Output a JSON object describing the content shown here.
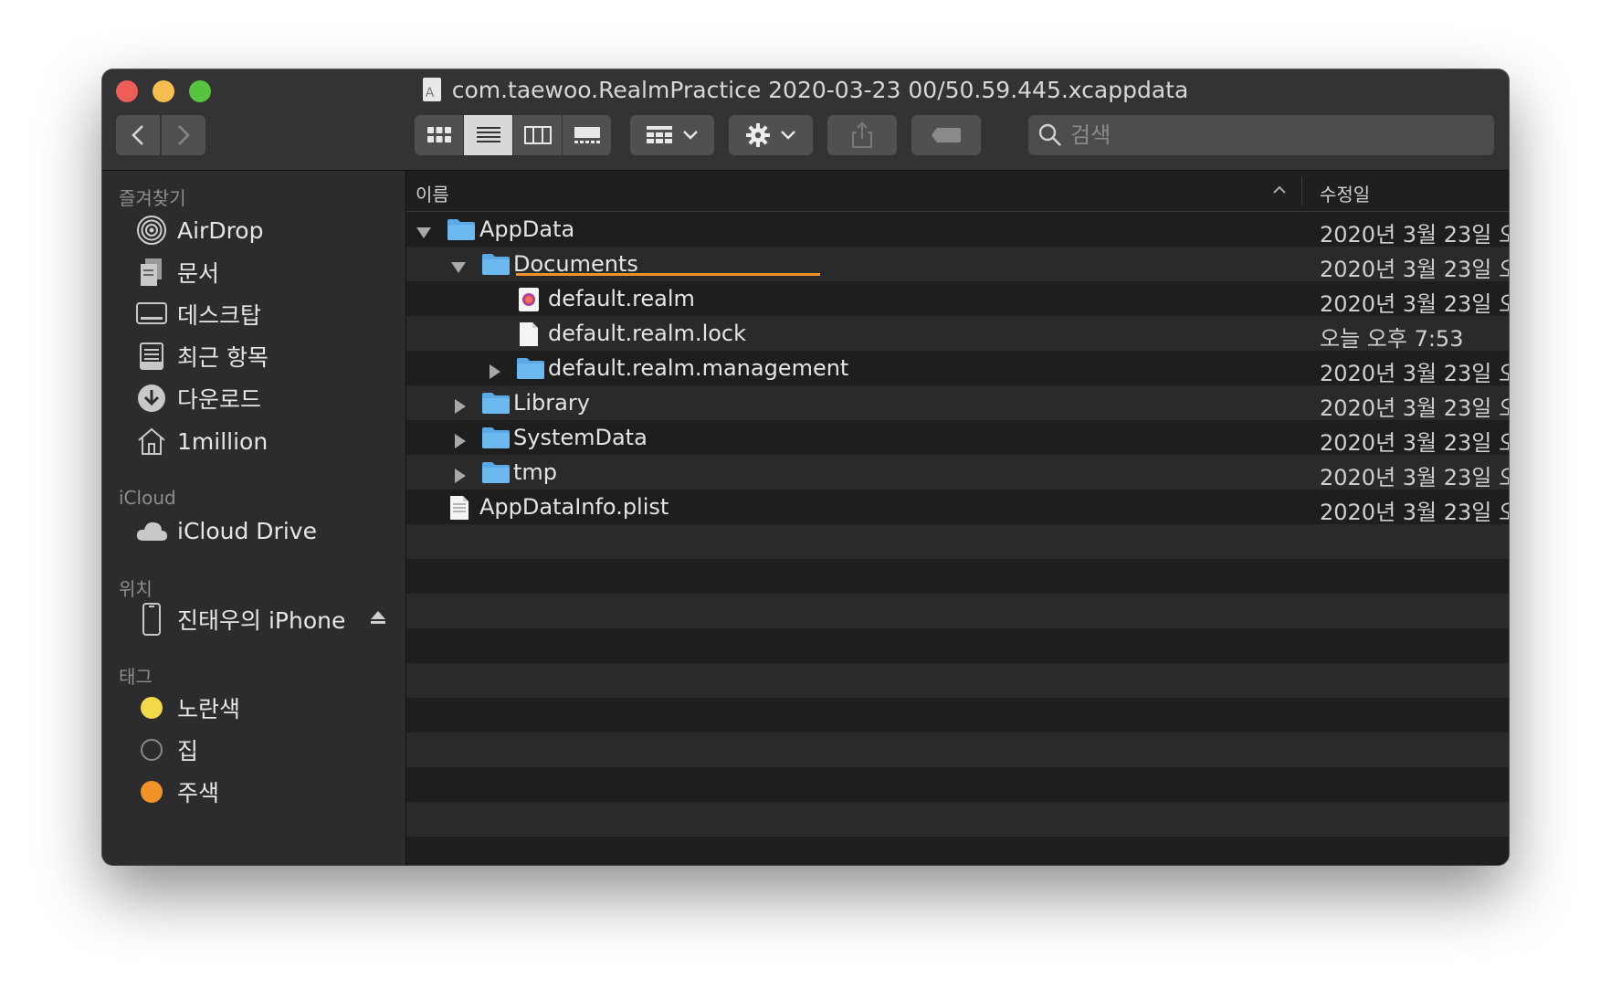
{
  "window": {
    "title": "com.taewoo.RealmPractice 2020-03-23 00/50.59.445.xcappdata"
  },
  "toolbar": {
    "view_modes": [
      "icon-view",
      "list-view",
      "column-view",
      "gallery-view"
    ],
    "active_view": "list-view",
    "search_placeholder": "검색"
  },
  "sidebar": {
    "favorites_header": "즐겨찾기",
    "favorites": [
      {
        "label": "AirDrop",
        "icon": "airdrop-icon"
      },
      {
        "label": "문서",
        "icon": "documents-icon"
      },
      {
        "label": "데스크탑",
        "icon": "desktop-icon"
      },
      {
        "label": "최근 항목",
        "icon": "recents-icon"
      },
      {
        "label": "다운로드",
        "icon": "downloads-icon"
      },
      {
        "label": "1million",
        "icon": "home-icon"
      }
    ],
    "icloud_header": "iCloud",
    "icloud_item": "iCloud Drive",
    "locations_header": "위치",
    "location_item": "진태우의 iPhone",
    "tags_header": "태그",
    "tags": [
      {
        "label": "노란색",
        "color": "#f2d94a"
      },
      {
        "label": "집",
        "color": "transparent"
      },
      {
        "label": "주색",
        "color": "#f2932a"
      }
    ]
  },
  "list": {
    "col_name": "이름",
    "col_date": "수정일",
    "rows": [
      {
        "name": "AppData",
        "date": "2020년 3월 23일 오",
        "type": "folder",
        "level": 0,
        "expanded": true
      },
      {
        "name": "Documents",
        "date": "2020년 3월 23일 오",
        "type": "folder",
        "level": 1,
        "expanded": true
      },
      {
        "name": "default.realm",
        "date": "2020년 3월 23일 오",
        "type": "realm",
        "level": 2
      },
      {
        "name": "default.realm.lock",
        "date": "오늘 오후 7:53",
        "type": "file",
        "level": 2
      },
      {
        "name": "default.realm.management",
        "date": "2020년 3월 23일 오",
        "type": "folder",
        "level": 2,
        "expanded": false
      },
      {
        "name": "Library",
        "date": "2020년 3월 23일 오",
        "type": "folder",
        "level": 1,
        "expanded": false
      },
      {
        "name": "SystemData",
        "date": "2020년 3월 23일 오",
        "type": "folder",
        "level": 1,
        "expanded": false
      },
      {
        "name": "tmp",
        "date": "2020년 3월 23일 오",
        "type": "folder",
        "level": 1,
        "expanded": false
      },
      {
        "name": "AppDataInfo.plist",
        "date": "2020년 3월 23일 오",
        "type": "plist",
        "level": 0
      }
    ]
  },
  "colors": {
    "window_bg": "#1e1e1e",
    "sidebar_bg": "#2c2b2d",
    "toolbar_bg": "#333335",
    "folder_blue": "#5aa9e6",
    "highlight_underline": "#f2932a"
  }
}
